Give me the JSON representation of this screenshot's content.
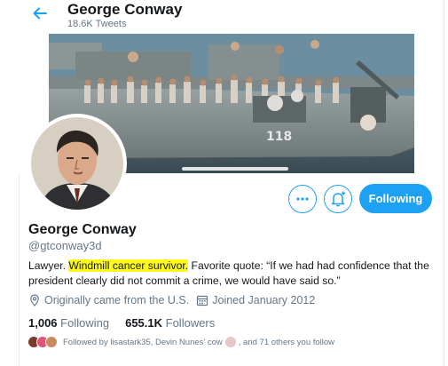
{
  "header": {
    "name": "George Conway",
    "tweet_count": "18.6K Tweets"
  },
  "banner": {
    "hull_number": "118"
  },
  "actions": {
    "more_icon": "ellipsis-icon",
    "notify_icon": "bell-plus-icon",
    "follow_label": "Following"
  },
  "profile": {
    "name": "George Conway",
    "handle": "@gtconway3d",
    "bio_pre": "Lawyer. ",
    "bio_highlight": "Windmill cancer survivor.",
    "bio_post": " Favorite quote: “If we had had confidence that the president clearly did not commit a crime, we would have said so.”",
    "location": "Originally came from the U.S.",
    "joined": "Joined January 2012",
    "following_count": "1,006",
    "following_label": "Following",
    "followers_count": "655.1K",
    "followers_label": "Followers",
    "followed_by": {
      "prefix": "Followed by lisastark35, Devin Nunes' cow",
      "suffix": ", and 71 others you follow"
    }
  },
  "colors": {
    "accent": "#1da1f2",
    "secondary_text": "#657786",
    "highlight": "#fff91a"
  }
}
